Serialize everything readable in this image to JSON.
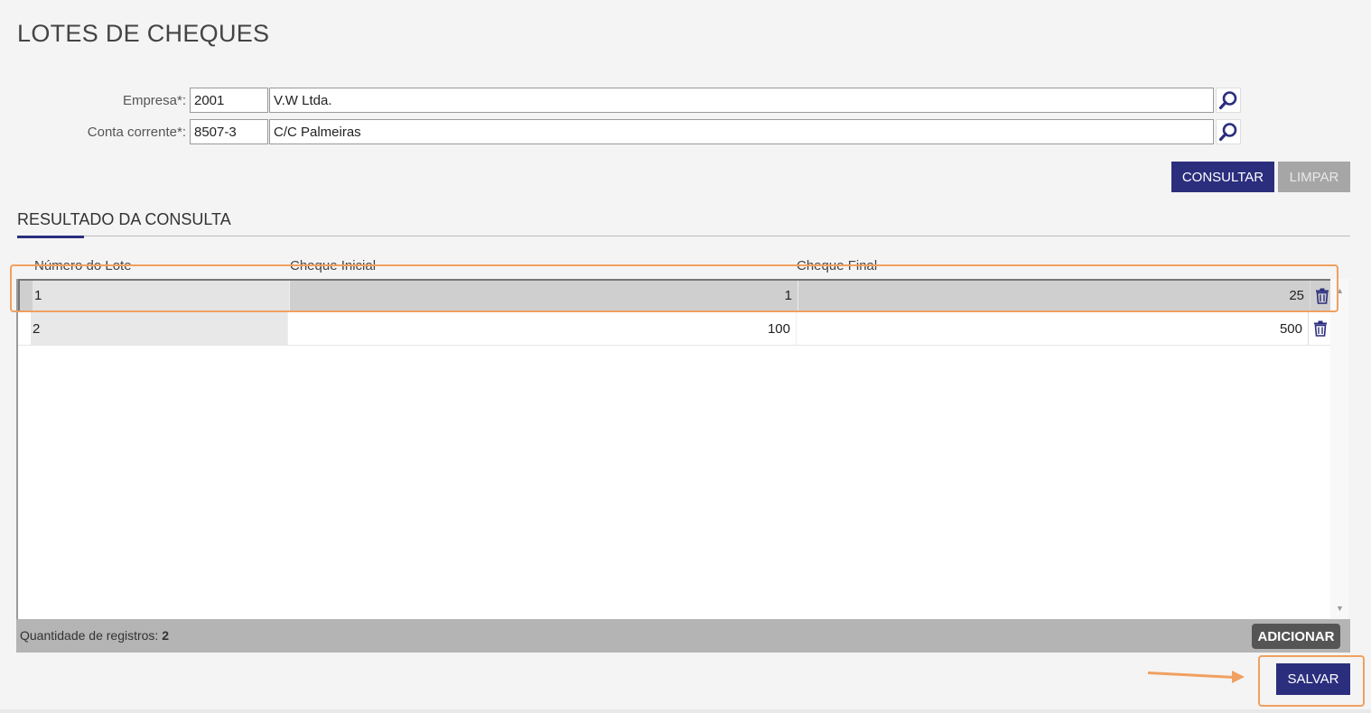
{
  "page": {
    "title": "LOTES DE CHEQUES"
  },
  "form": {
    "empresa": {
      "label": "Empresa*:",
      "code": "2001",
      "name": "V.W Ltda."
    },
    "conta": {
      "label": "Conta corrente*:",
      "code": "8507-3",
      "name": "C/C Palmeiras"
    }
  },
  "actions": {
    "consultar": "CONSULTAR",
    "limpar": "LIMPAR",
    "salvar": "SALVAR"
  },
  "result": {
    "title": "RESULTADO DA CONSULTA",
    "columns": [
      "Número do Lote",
      "Cheque Inicial",
      "Cheque Final"
    ],
    "rows": [
      {
        "lote": "1",
        "inicial": "1",
        "final": "25"
      },
      {
        "lote": "2",
        "inicial": "100",
        "final": "500"
      }
    ],
    "footer": {
      "label": "Quantidade de registros:",
      "count": "2",
      "add": "ADICIONAR"
    }
  },
  "icons": {
    "search": "magnifier-icon",
    "delete": "trash-icon"
  },
  "colors": {
    "primary": "#2b2e7d",
    "highlight": "#f0a060"
  }
}
